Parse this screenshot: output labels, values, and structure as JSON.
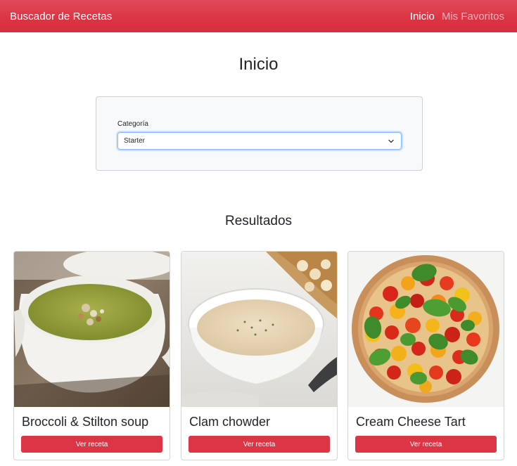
{
  "navbar": {
    "brand": "Buscador de Recetas",
    "links": [
      {
        "label": "Inicio",
        "active": true
      },
      {
        "label": "Mis Favoritos",
        "active": false
      }
    ],
    "color": "#dc3545"
  },
  "page": {
    "title": "Inicio"
  },
  "filter": {
    "label": "Categoría",
    "selected": "Starter"
  },
  "results": {
    "title": "Resultados",
    "cards": [
      {
        "title": "Broccoli & Stilton soup",
        "button": "Ver receta",
        "image": "broccoli-stilton-soup"
      },
      {
        "title": "Clam chowder",
        "button": "Ver receta",
        "image": "clam-chowder"
      },
      {
        "title": "Cream Cheese Tart",
        "button": "Ver receta",
        "image": "cream-cheese-tomato-tart"
      }
    ]
  }
}
